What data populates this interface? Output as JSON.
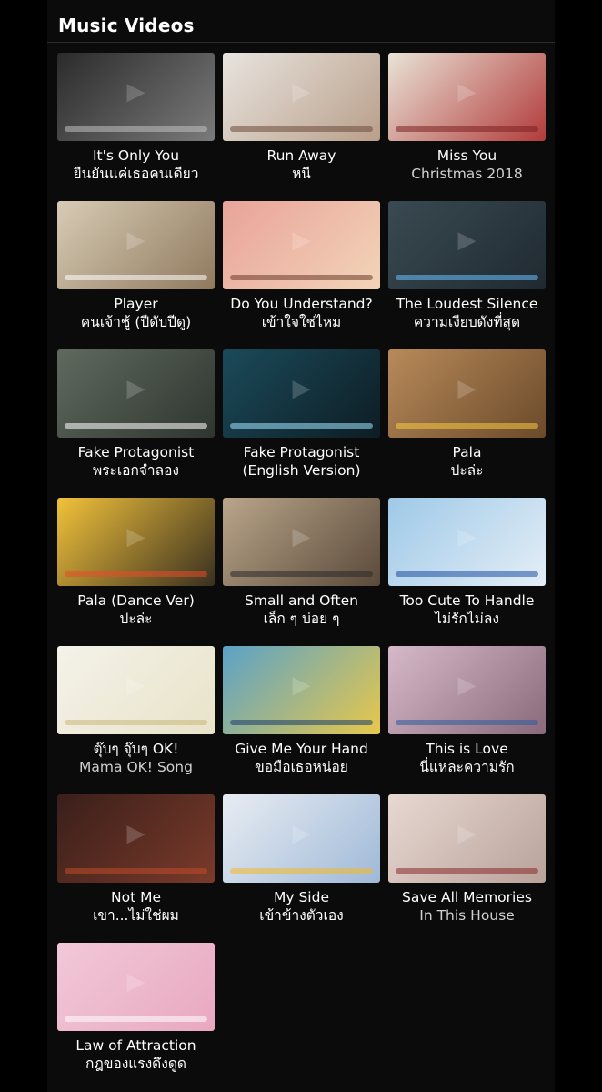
{
  "section": {
    "title": "Music Videos"
  },
  "videos": [
    {
      "line1": "It's Only You",
      "line2": "ยืนยันแค่เธอคนเดียว",
      "l2dim": false,
      "c1": "#2b2b2b",
      "c2": "#7a7a7a",
      "acc": "#bfbfbf"
    },
    {
      "line1": "Run Away",
      "line2": "หนี",
      "l2dim": false,
      "c1": "#e8e4df",
      "c2": "#b99f8a",
      "acc": "#6b4a3a"
    },
    {
      "line1": "Miss You",
      "line2": "Christmas 2018",
      "l2dim": true,
      "c1": "#e9e3d6",
      "c2": "#b23b3b",
      "acc": "#7b2020"
    },
    {
      "line1": "Player",
      "line2": "คนเจ้าชู้ (ปีดับปีดู)",
      "l2dim": false,
      "c1": "#d8cbb5",
      "c2": "#8f7a5e",
      "acc": "#ffffff"
    },
    {
      "line1": "Do You Understand?",
      "line2": "เข้าใจใช่ไหม",
      "l2dim": false,
      "c1": "#e9a39a",
      "c2": "#f2d4b8",
      "acc": "#6a3a2a"
    },
    {
      "line1": "The Loudest Silence",
      "line2": "ความเงียบดังที่สุด",
      "l2dim": false,
      "c1": "#3a4a52",
      "c2": "#1f2a30",
      "acc": "#6ac0ff"
    },
    {
      "line1": "Fake Protagonist",
      "line2": "พระเอกจำลอง",
      "l2dim": false,
      "c1": "#5f6a5f",
      "c2": "#2f352f",
      "acc": "#ffffff"
    },
    {
      "line1": "Fake Protagonist",
      "line2": "(English Version)",
      "l2dim": false,
      "c1": "#1b4a5a",
      "c2": "#0d1d24",
      "acc": "#9fe3ff"
    },
    {
      "line1": "Pala",
      "line2": "ปะล่ะ",
      "l2dim": false,
      "c1": "#b88a5a",
      "c2": "#6b4a2a",
      "acc": "#f5c842"
    },
    {
      "line1": "Pala (Dance Ver)",
      "line2": "ปะล่ะ",
      "l2dim": false,
      "c1": "#f2c23a",
      "c2": "#3a3020",
      "acc": "#e84a2a"
    },
    {
      "line1": "Small and Often",
      "line2": "เล็ก ๆ บ่อย ๆ",
      "l2dim": false,
      "c1": "#b9a58a",
      "c2": "#5a4a3a",
      "acc": "#2a2a2a"
    },
    {
      "line1": "Too Cute To Handle",
      "line2": "ไม่รักไม่ลง",
      "l2dim": false,
      "c1": "#9fc9e8",
      "c2": "#e4eef6",
      "acc": "#1e4fa0"
    },
    {
      "line1": "ตุ๊บๆ จุ๊บๆ OK!",
      "line2": "Mama OK! Song",
      "l2dim": true,
      "c1": "#f4f2ea",
      "c2": "#e8e3c8",
      "acc": "#c8b87a"
    },
    {
      "line1": "Give Me Your Hand",
      "line2": "ขอมือเธอหน่อย",
      "l2dim": false,
      "c1": "#5aa2c8",
      "c2": "#e8c84a",
      "acc": "#1a3a6a"
    },
    {
      "line1": "This is Love",
      "line2": "นี่แหละความรัก",
      "l2dim": false,
      "c1": "#d6b9c9",
      "c2": "#8a6a7a",
      "acc": "#2a5aa0"
    },
    {
      "line1": "Not Me",
      "line2": "เขา...ไม่ใช่ผม",
      "l2dim": false,
      "c1": "#3a1f1a",
      "c2": "#7a3a2a",
      "acc": "#c04a2a"
    },
    {
      "line1": "My Side",
      "line2": "เข้าข้างตัวเอง",
      "l2dim": false,
      "c1": "#e8ecf2",
      "c2": "#9fb9d8",
      "acc": "#f2b82a"
    },
    {
      "line1": "Save All Memories",
      "line2": "In This House",
      "l2dim": true,
      "c1": "#e8d8d2",
      "c2": "#b8a29a",
      "acc": "#8a2a2a"
    },
    {
      "line1": "Law of Attraction",
      "line2": "กฎของแรงดึงดูด",
      "l2dim": false,
      "c1": "#f2c8d8",
      "c2": "#e8a8c0",
      "acc": "#ffffff"
    }
  ]
}
